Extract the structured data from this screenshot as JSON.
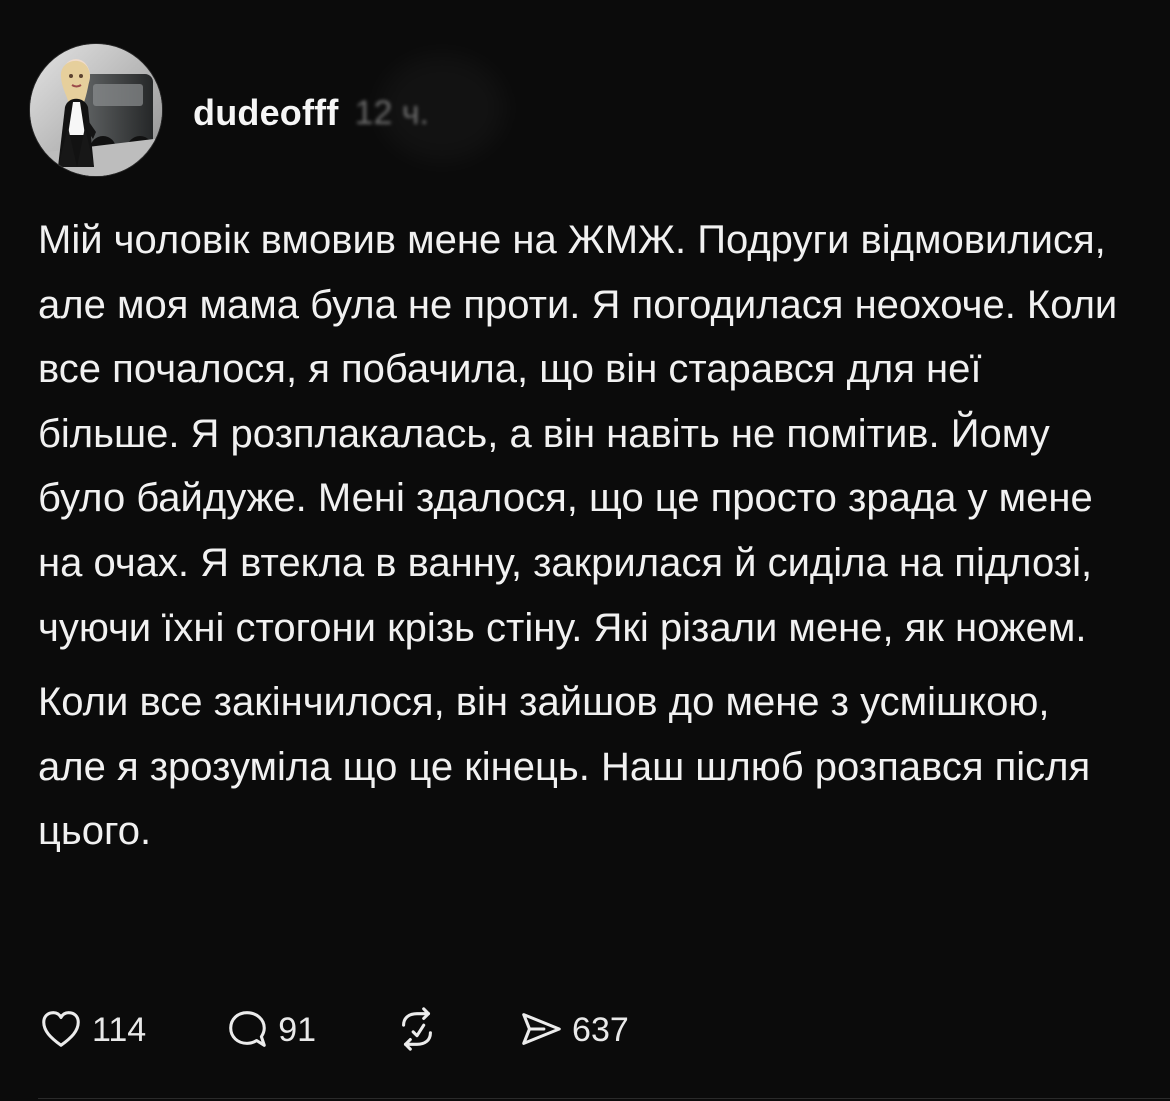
{
  "post": {
    "author": {
      "username": "dudeofff",
      "time_ago": "12 ч."
    },
    "body": {
      "paragraph_1": "Мій чоловік вмовив мене на ЖМЖ. Подруги відмовилися, але моя мама була не проти. Я погодилася неохоче. Коли все почалося, я побачила, що він старався для неї більше. Я розплакалась, а він навіть не помітив. Йому було байдуже. Мені здалося, що це просто зрада у мене на очах. Я втекла в ванну, закрилася й сиділа на підлозі, чуючи їхні стогони крізь стіну. Які різали мене, як ножем.",
      "paragraph_2": "Коли все закінчилося, він зайшов до мене з усмішкою, але я зрозуміла що це кінець. Наш шлюб розпався після цього."
    },
    "actions": {
      "likes": "114",
      "comments": "91",
      "shares": "637"
    },
    "icons": {
      "like": "heart-icon",
      "comment": "comment-bubble-icon",
      "repost": "repost-icon",
      "share": "send-icon"
    },
    "colors": {
      "background": "#0b0b0b",
      "text": "#f1f1f1",
      "muted_time": "#8c8c8c",
      "divider": "#202020"
    }
  }
}
